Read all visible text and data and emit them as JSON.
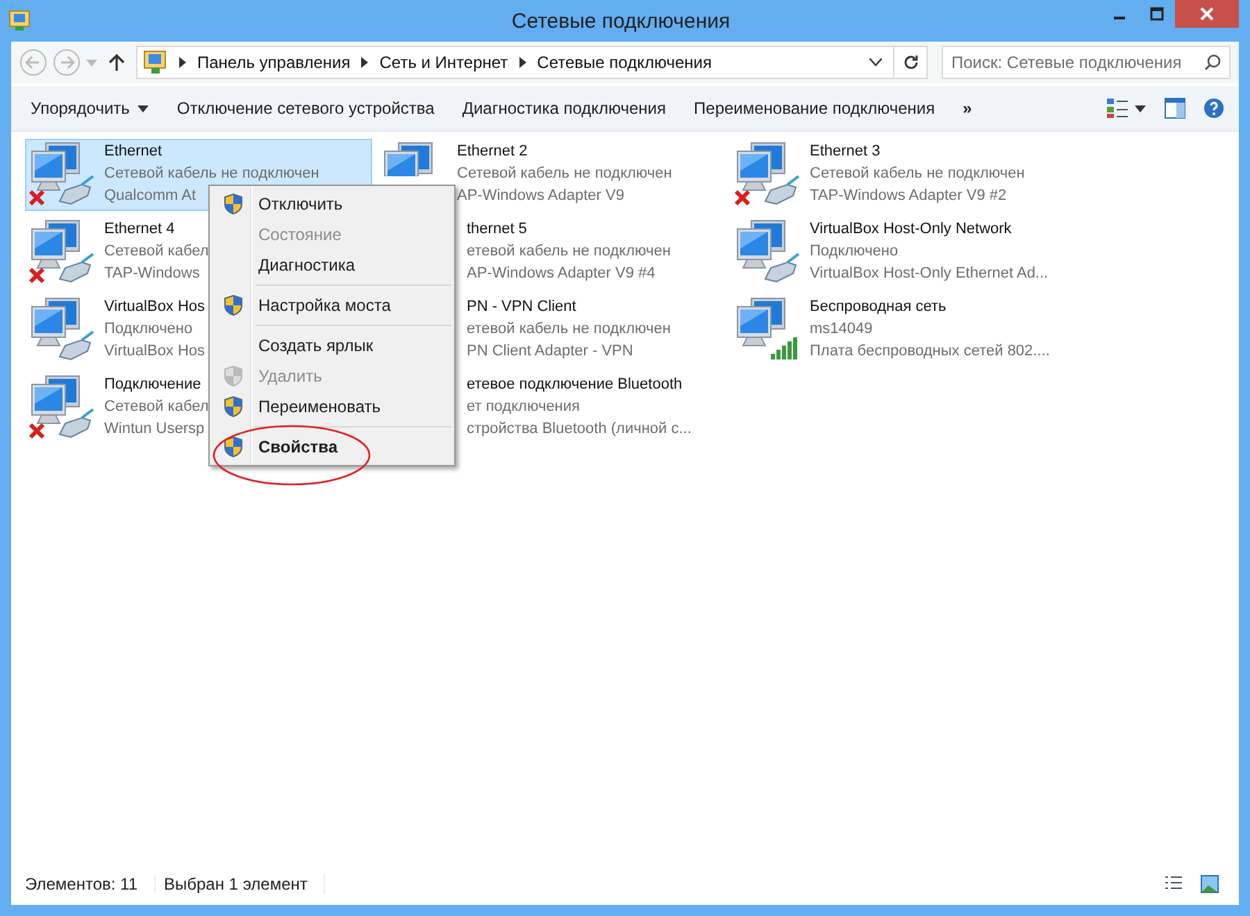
{
  "window": {
    "title": "Сетевые подключения"
  },
  "address": {
    "crumbs": [
      "Панель управления",
      "Сеть и Интернет",
      "Сетевые подключения"
    ]
  },
  "search": {
    "placeholder": "Поиск: Сетевые подключения"
  },
  "toolbar": {
    "items": [
      {
        "label": "Упорядочить",
        "dropdown": true
      },
      {
        "label": "Отключение сетевого устройства",
        "dropdown": false
      },
      {
        "label": "Диагностика подключения",
        "dropdown": false
      },
      {
        "label": "Переименование подключения",
        "dropdown": false
      }
    ],
    "more": "»"
  },
  "connections": [
    {
      "name": "Ethernet",
      "status": "Сетевой кабель не подключен",
      "device": "Qualcomm At",
      "kind": "disconnected",
      "selected": true
    },
    {
      "name": "Ethernet 2",
      "status": "Сетевой кабель не подключен",
      "device": "AP-Windows Adapter V9",
      "kind": "covered",
      "selected": false
    },
    {
      "name": "Ethernet 3",
      "status": "Сетевой кабель не подключен",
      "device": "TAP-Windows Adapter V9 #2",
      "kind": "disconnected",
      "selected": false
    },
    {
      "name": "Ethernet 4",
      "status": "Сетевой кабел",
      "device": "TAP-Windows",
      "kind": "disconnected",
      "selected": false
    },
    {
      "name": "thernet 5",
      "status": "етевой кабель не подключен",
      "device": "AP-Windows Adapter V9 #4",
      "kind": "hidden",
      "selected": false
    },
    {
      "name": "VirtualBox Host-Only Network",
      "status": "Подключено",
      "device": "VirtualBox Host-Only Ethernet Ad...",
      "kind": "connected",
      "selected": false
    },
    {
      "name": "VirtualBox Hos",
      "status": "Подключено",
      "device": "VirtualBox Hos",
      "kind": "connected",
      "selected": false
    },
    {
      "name": "PN - VPN Client",
      "status": "етевой кабель не подключен",
      "device": "PN Client Adapter - VPN",
      "kind": "hidden",
      "selected": false
    },
    {
      "name": "Беспроводная сеть",
      "status": "ms14049",
      "device": "Плата беспроводных сетей 802....",
      "kind": "wireless",
      "selected": false
    },
    {
      "name": "Подключение",
      "status": "Сетевой кабел",
      "device": "Wintun Usersp",
      "kind": "disconnected",
      "selected": false
    },
    {
      "name": "етевое подключение Bluetooth",
      "status": "ет подключения",
      "device": "стройства Bluetooth (личной с...",
      "kind": "hidden",
      "selected": false
    }
  ],
  "context_menu": [
    {
      "kind": "item",
      "label": "Отключить",
      "shield": true,
      "disabled": false,
      "default": false
    },
    {
      "kind": "item",
      "label": "Состояние",
      "shield": false,
      "disabled": true,
      "default": false
    },
    {
      "kind": "item",
      "label": "Диагностика",
      "shield": false,
      "disabled": false,
      "default": false
    },
    {
      "kind": "separator"
    },
    {
      "kind": "item",
      "label": "Настройка моста",
      "shield": true,
      "disabled": false,
      "default": false
    },
    {
      "kind": "separator"
    },
    {
      "kind": "item",
      "label": "Создать ярлык",
      "shield": false,
      "disabled": false,
      "default": false
    },
    {
      "kind": "item",
      "label": "Удалить",
      "shield": true,
      "disabled": true,
      "default": false
    },
    {
      "kind": "item",
      "label": "Переименовать",
      "shield": true,
      "disabled": false,
      "default": false
    },
    {
      "kind": "separator"
    },
    {
      "kind": "item",
      "label": "Свойства",
      "shield": true,
      "disabled": false,
      "default": true
    }
  ],
  "status_bar": {
    "count": "Элементов: 11",
    "selection": "Выбран 1 элемент"
  }
}
